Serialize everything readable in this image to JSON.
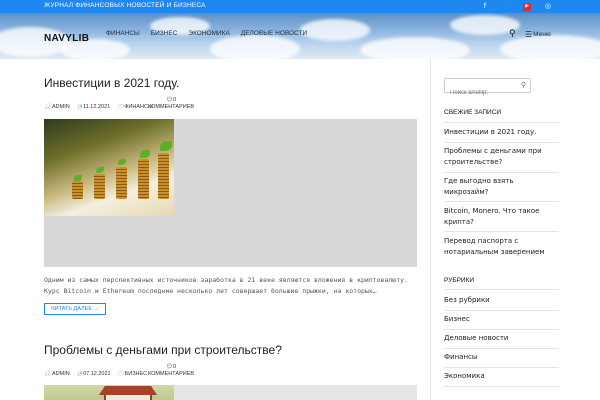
{
  "topbar": {
    "tagline": "ЖУРНАЛ ФИНАНСОВЫХ НОВОСТЕЙ И БИЗНЕСА",
    "social_icons": [
      "facebook-icon",
      "twitter-icon",
      "youtube-icon",
      "instagram-icon"
    ],
    "accent_color": "#1e87f0"
  },
  "header": {
    "logo": "NAVYLIB",
    "nav": [
      "Финансы",
      "Бизнес",
      "Экономика",
      "Деловые новости"
    ],
    "menu_label": "Меню"
  },
  "posts": [
    {
      "title": "Инвестиции в 2021 году.",
      "author": "ADMIN",
      "date": "11.12.2021",
      "category": "ФИНАНСЫ",
      "comments_count": "0",
      "comments_label": "КОММЕНТАРИЕВ",
      "excerpt_line1": "Одним из самых перспективных источников заработка в 21 веке являются вложения в криптовалюту.",
      "excerpt_line2": "Курс Bitcoin и Ethereum последние несколько лет совершает большие прыжки, на которых…",
      "read_more": "ЧИТАТЬ ДАЛЕЕ →"
    },
    {
      "title": "Проблемы с деньгами при строительстве?",
      "author": "ADMIN",
      "date": "07.12.2021",
      "category": "БИЗНЕС",
      "comments_count": "0",
      "comments_label": "КОММЕНТАРИЕВ"
    }
  ],
  "sidebar": {
    "search_placeholder": "Поиск &hellip;",
    "recent_title": "СВЕЖИЕ ЗАПИСИ",
    "recent": [
      "Инвестиции в 2021 году.",
      "Проблемы с деньгами при строительстве?",
      "Где выгодно взять микрозайм?",
      "Bitcoin, Monero. Что такое крипта?",
      "Перевод паспорта с нотариальным заверением"
    ],
    "rubrics_title": "РУБРИКИ",
    "rubrics": [
      "Без рубрики",
      "Бизнес",
      "Деловые новости",
      "Финансы",
      "Экономика"
    ]
  }
}
